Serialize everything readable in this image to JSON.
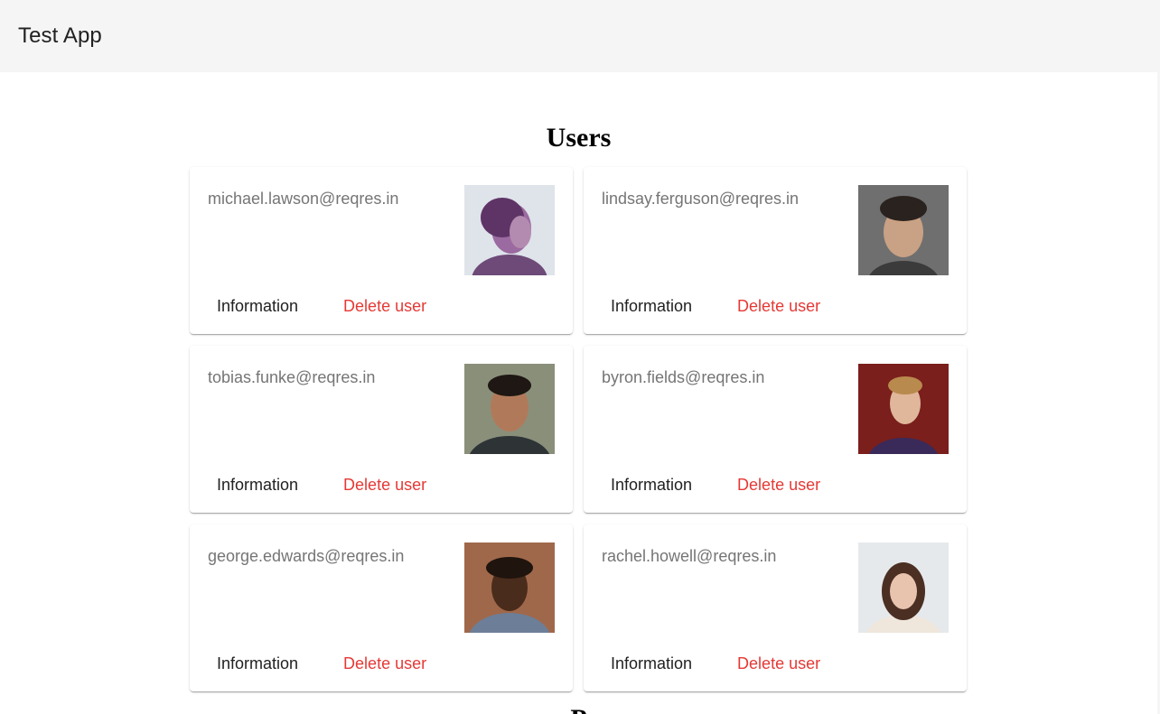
{
  "app": {
    "title": "Test App"
  },
  "sections": {
    "users_title": "Users",
    "next_title": "P"
  },
  "users": [
    {
      "email": "michael.lawson@reqres.in",
      "info_label": "Information",
      "delete_label": "Delete user"
    },
    {
      "email": "lindsay.ferguson@reqres.in",
      "info_label": "Information",
      "delete_label": "Delete user"
    },
    {
      "email": "tobias.funke@reqres.in",
      "info_label": "Information",
      "delete_label": "Delete user"
    },
    {
      "email": "byron.fields@reqres.in",
      "info_label": "Information",
      "delete_label": "Delete user"
    },
    {
      "email": "george.edwards@reqres.in",
      "info_label": "Information",
      "delete_label": "Delete user"
    },
    {
      "email": "rachel.howell@reqres.in",
      "info_label": "Information",
      "delete_label": "Delete user"
    }
  ],
  "colors": {
    "app_bar": "#f5f5f5",
    "delete": "#e53935",
    "email_text": "#757575"
  }
}
